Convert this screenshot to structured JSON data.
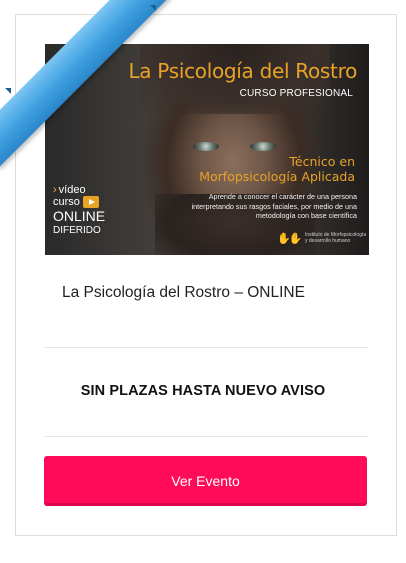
{
  "image": {
    "title": "La Psicología del Rostro",
    "subtitle": "CURSO PROFESIONAL",
    "tecnico_line1": "Técnico en",
    "tecnico_line2": "Morfopsicología Aplicada",
    "description": "Aprende a conocer el carácter de una persona interpretando sus rasgos faciales, por medio de una metodología con base científica",
    "video_word": "vídeo",
    "curso_word": "curso",
    "online_word": "ONLINE",
    "diferido_word": "DIFERIDO",
    "logo_text": "Instituto de Morfopsicología y desarrollo humano",
    "accent_color": "#e8a327"
  },
  "ribbon": {
    "color": "#3fa0e0"
  },
  "card": {
    "event_title": "La Psicología del Rostro – ONLINE",
    "status": "SIN PLAZAS HASTA NUEVO AVISO",
    "button_label": "Ver Evento",
    "button_color": "#ff0b5a"
  }
}
